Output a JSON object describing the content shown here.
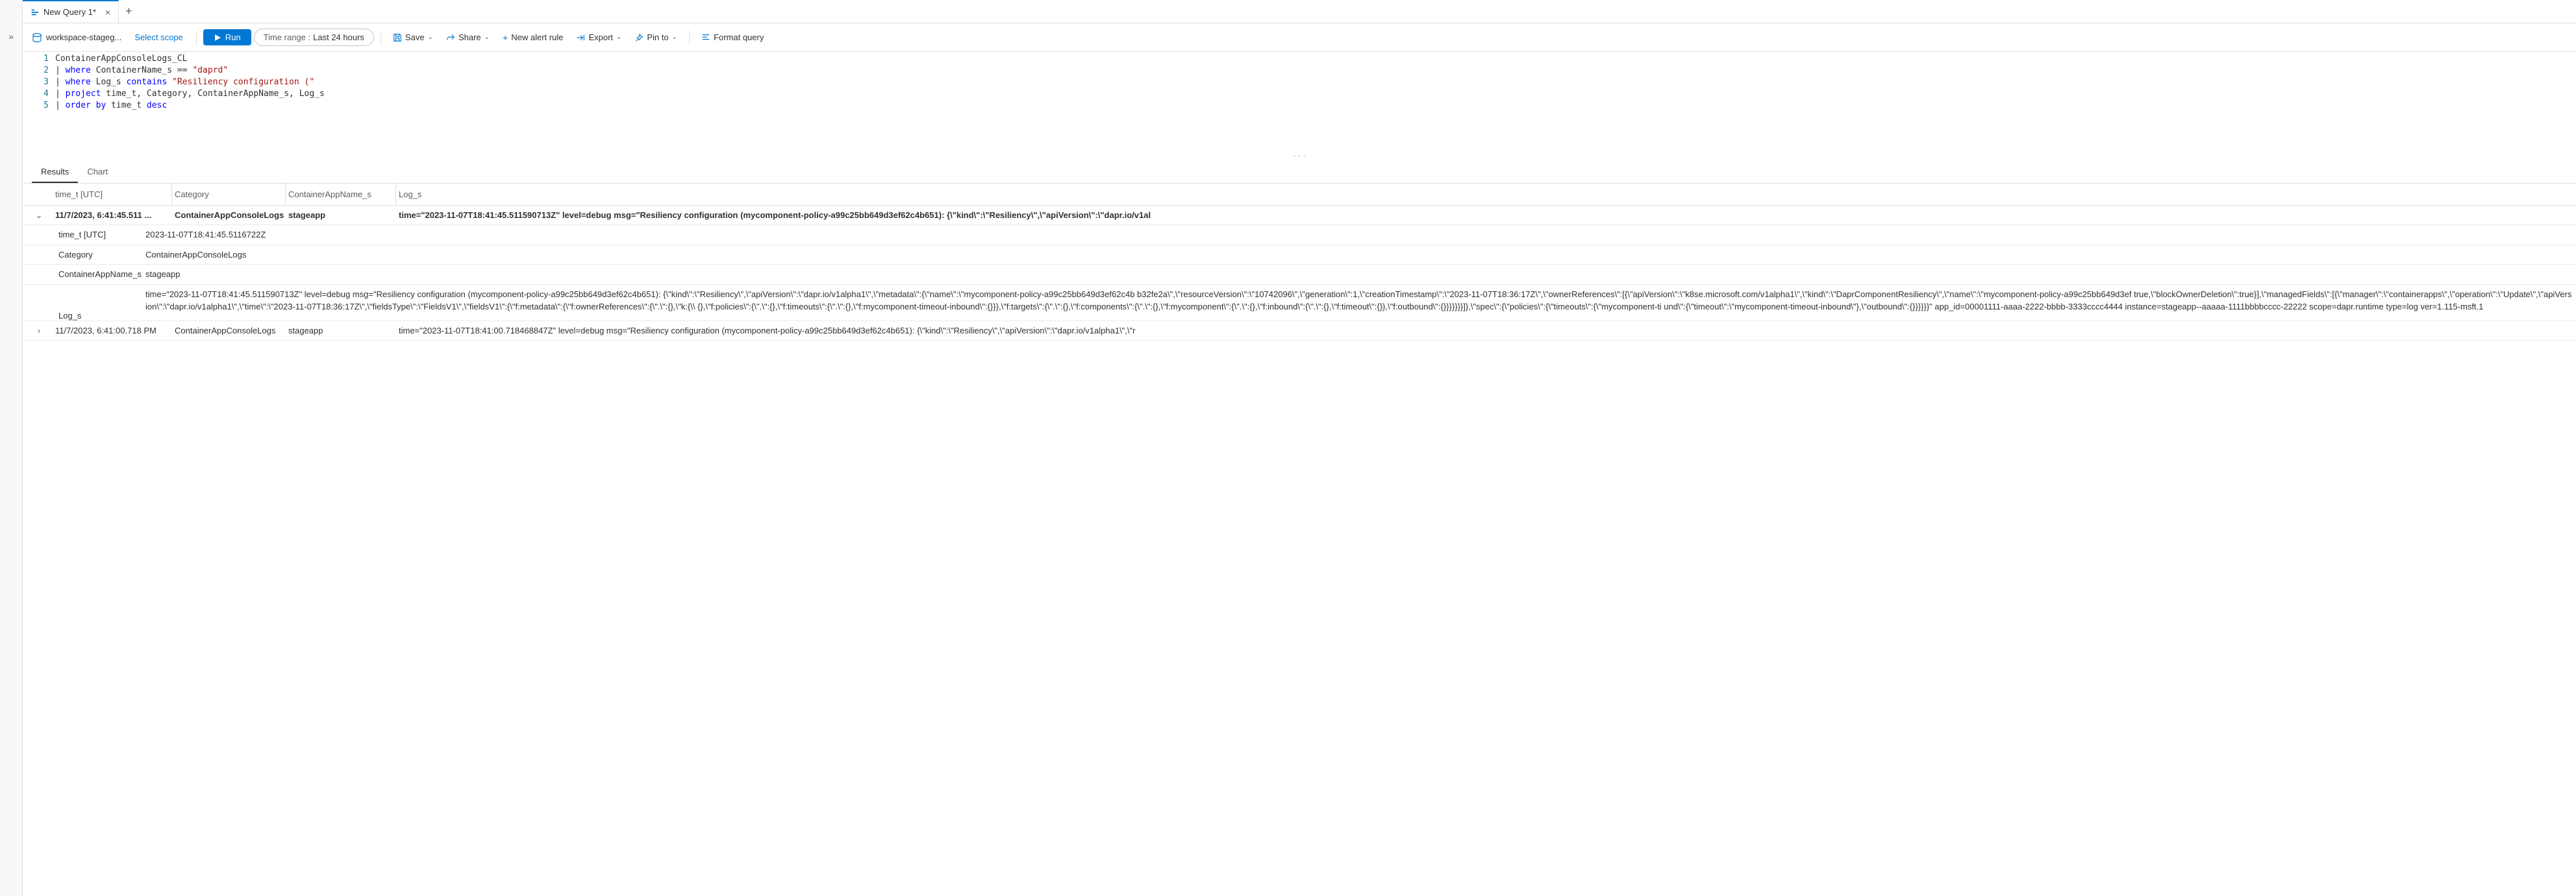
{
  "tabs": {
    "active_label": "New Query 1*"
  },
  "toolbar": {
    "workspace": "workspace-stageg...",
    "scope": "Select scope",
    "run": "Run",
    "time_label": "Time range :",
    "time_value": "Last 24 hours",
    "save": "Save",
    "share": "Share",
    "new_alert": "New alert rule",
    "export": "Export",
    "pin": "Pin to",
    "format": "Format query"
  },
  "query": {
    "l1": "ContainerAppConsoleLogs_CL",
    "l2_pipe": "| ",
    "l2_kw": "where",
    "l2_rest": " ContainerName_s == ",
    "l2_str": "\"daprd\"",
    "l3_pipe": "| ",
    "l3_kw": "where",
    "l3_mid": " Log_s ",
    "l3_kw2": "contains",
    "l3_sp": " ",
    "l3_str": "\"Resiliency configuration (\"",
    "l4_pipe": "| ",
    "l4_kw": "project",
    "l4_rest": " time_t, Category, ContainerAppName_s, Log_s",
    "l5_pipe": "| ",
    "l5_kw": "order by",
    "l5_mid": " time_t ",
    "l5_kw2": "desc"
  },
  "gutter": [
    "1",
    "2",
    "3",
    "4",
    "5"
  ],
  "splitter": "· · ·",
  "results": {
    "tab_results": "Results",
    "tab_chart": "Chart",
    "headers": {
      "time": "time_t [UTC]",
      "category": "Category",
      "app": "ContainerAppName_s",
      "log": "Log_s"
    },
    "row1": {
      "time": "11/7/2023, 6:41:45.511 ...",
      "category": "ContainerAppConsoleLogs",
      "app": "stageapp",
      "log": "time=\"2023-11-07T18:41:45.511590713Z\" level=debug msg=\"Resiliency configuration (mycomponent-policy-a99c25bb649d3ef62c4b651): {\\\"kind\\\":\\\"Resiliency\\\",\\\"apiVersion\\\":\\\"dapr.io/v1al"
    },
    "details": {
      "k1": "time_t [UTC]",
      "v1": "2023-11-07T18:41:45.5116722Z",
      "k2": "Category",
      "v2": "ContainerAppConsoleLogs",
      "k3": "ContainerAppName_s",
      "v3": "stageapp",
      "k4": "Log_s",
      "v4": "time=\"2023-11-07T18:41:45.511590713Z\" level=debug msg=\"Resiliency configuration (mycomponent-policy-a99c25bb649d3ef62c4b651): {\\\"kind\\\":\\\"Resiliency\\\",\\\"apiVersion\\\":\\\"dapr.io/v1alpha1\\\",\\\"metadata\\\":{\\\"name\\\":\\\"mycomponent-policy-a99c25bb649d3ef62c4b b32fe2a\\\",\\\"resourceVersion\\\":\\\"10742096\\\",\\\"generation\\\":1,\\\"creationTimestamp\\\":\\\"2023-11-07T18:36:17Z\\\",\\\"ownerReferences\\\":[{\\\"apiVersion\\\":\\\"k8se.microsoft.com/v1alpha1\\\",\\\"kind\\\":\\\"DaprComponentResiliency\\\",\\\"name\\\":\\\"mycomponent-policy-a99c25bb649d3ef true,\\\"blockOwnerDeletion\\\":true}],\\\"managedFields\\\":[{\\\"manager\\\":\\\"containerapps\\\",\\\"operation\\\":\\\"Update\\\",\\\"apiVersion\\\":\\\"dapr.io/v1alpha1\\\",\\\"time\\\":\\\"2023-11-07T18:36:17Z\\\",\\\"fieldsType\\\":\\\"FieldsV1\\\",\\\"fieldsV1\\\":{\\\"f:metadata\\\":{\\\"f:ownerReferences\\\":{\\\".\\\":{},\\\"k:{\\\\ {},\\\"f:policies\\\":{\\\".\\\":{},\\\"f:timeouts\\\":{\\\".\\\":{},\\\"f:mycomponent-timeout-inbound\\\":{}}},\\\"f:targets\\\":{\\\".\\\":{},\\\"f:components\\\":{\\\".\\\":{},\\\"f:mycomponent\\\":{\\\".\\\":{},\\\"f:inbound\\\":{\\\".\\\":{},\\\"f:timeout\\\":{}},\\\"f:outbound\\\":{}}}}}}}]},\\\"spec\\\":{\\\"policies\\\":{\\\"timeouts\\\":{\\\"mycomponent-ti und\\\":{\\\"timeout\\\":\\\"mycomponent-timeout-inbound\\\"},\\\"outbound\\\":{}}}}}}\" app_id=00001111-aaaa-2222-bbbb-3333cccc4444 instance=stageapp--aaaaa-1111bbbbcccc-22222 scope=dapr.runtime type=log ver=1.115-msft.1"
    },
    "row2": {
      "time": "11/7/2023, 6:41:00.718 PM",
      "category": "ContainerAppConsoleLogs",
      "app": "stageapp",
      "log": "time=\"2023-11-07T18:41:00.718468847Z\" level=debug msg=\"Resiliency configuration (mycomponent-policy-a99c25bb649d3ef62c4b651): {\\\"kind\\\":\\\"Resiliency\\\",\\\"apiVersion\\\":\\\"dapr.io/v1alpha1\\\",\\\"r"
    }
  }
}
